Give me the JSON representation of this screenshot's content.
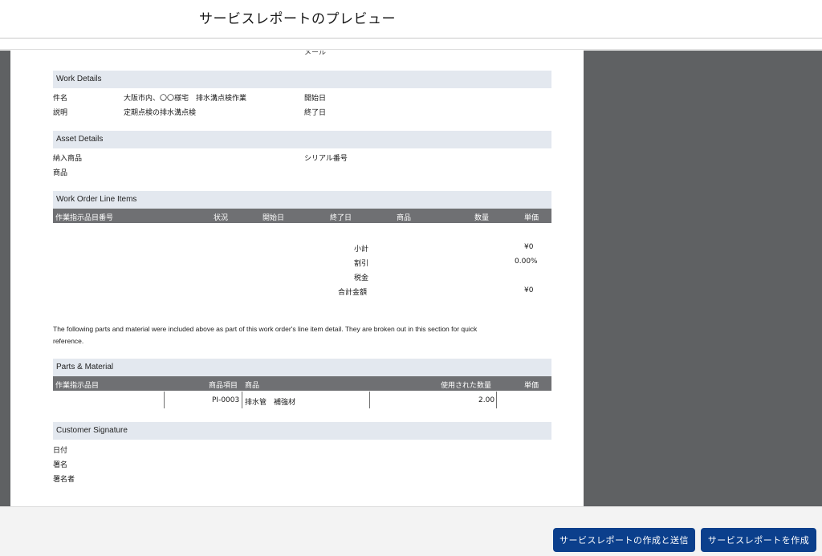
{
  "modal": {
    "title": "サービスレポートのプレビュー"
  },
  "report": {
    "top_partial_label": "メール",
    "work_details": {
      "title": "Work Details",
      "subject_label": "件名",
      "subject_value": "大阪市内、〇〇様宅　排水溝点検作業",
      "description_label": "説明",
      "description_value": "定期点検の排水溝点検",
      "start_label": "開始日",
      "end_label": "終了日"
    },
    "asset_details": {
      "title": "Asset Details",
      "installed_product_label": "納入商品",
      "product_label": "商品",
      "serial_label": "シリアル番号"
    },
    "line_items": {
      "title": "Work Order Line Items",
      "headers": [
        "作業指示品目番号",
        "状況",
        "開始日",
        "終了日",
        "商品",
        "数量",
        "単価"
      ],
      "subtotal_label": "小計",
      "subtotal_value": "¥0",
      "discount_label": "割引",
      "discount_value": "0.00%",
      "tax_label": "税金",
      "total_label": "合計金額",
      "total_value": "¥0"
    },
    "note": "The following parts and material were included above as part of this work order's line item detail. They are broken out in this section for quick reference.",
    "parts": {
      "title": "Parts & Material",
      "headers": [
        "作業指示品目",
        "商品項目",
        "商品",
        "使用された数量",
        "単価"
      ],
      "row": {
        "item_number": "PI-0003",
        "product": "排水管　補強材",
        "quantity": "2.00"
      }
    },
    "signature": {
      "title": "Customer Signature",
      "date_label": "日付",
      "signature_label": "署名",
      "signer_label": "署名者"
    }
  },
  "footer": {
    "send_button": "サービスレポートの作成と送信",
    "create_button": "サービスレポートを作成"
  }
}
